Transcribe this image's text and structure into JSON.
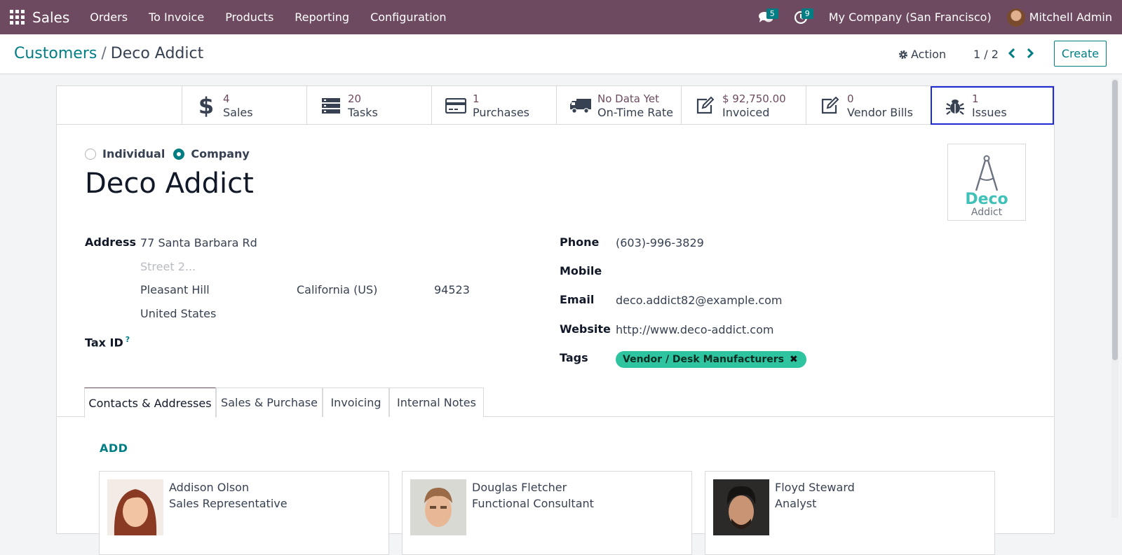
{
  "nav": {
    "app_name": "Sales",
    "menu": [
      "Orders",
      "To Invoice",
      "Products",
      "Reporting",
      "Configuration"
    ],
    "messages_count": "5",
    "activities_count": "9",
    "company": "My Company (San Francisco)",
    "user": "Mitchell Admin",
    "accent_color": "#6d4a60"
  },
  "control": {
    "breadcrumb_parent": "Customers",
    "breadcrumb_separator": "/",
    "breadcrumb_current": "Deco Addict",
    "action_label": "Action",
    "pager": "1 / 2",
    "create_label": "Create"
  },
  "stats": [
    {
      "value": "4",
      "label": "Sales",
      "icon": "dollar-icon"
    },
    {
      "value": "20",
      "label": "Tasks",
      "icon": "tasks-icon"
    },
    {
      "value": "1",
      "label": "Purchases",
      "icon": "credit-card-icon"
    },
    {
      "value": "No Data Yet",
      "label": "On-Time Rate",
      "icon": "truck-icon"
    },
    {
      "value": "$ 92,750.00",
      "label": "Invoiced",
      "icon": "edit-icon"
    },
    {
      "value": "0",
      "label": "Vendor Bills",
      "icon": "edit-icon"
    },
    {
      "value": "1",
      "label": "Issues",
      "icon": "bug-icon"
    }
  ],
  "form": {
    "type_individual": "Individual",
    "type_company": "Company",
    "selected_type": "Company",
    "name": "Deco Addict",
    "logo_text_1": "Deco",
    "logo_text_2": "Addict",
    "address_label": "Address",
    "street": "77 Santa Barbara Rd",
    "street2_placeholder": "Street 2...",
    "city": "Pleasant Hill",
    "state": "California (US)",
    "zip": "94523",
    "country": "United States",
    "tax_id_label": "Tax ID",
    "tax_id_help": "?",
    "phone_label": "Phone",
    "phone": "(603)-996-3829",
    "mobile_label": "Mobile",
    "email_label": "Email",
    "email": "deco.addict82@example.com",
    "website_label": "Website",
    "website": "http://www.deco-addict.com",
    "tags_label": "Tags",
    "tag": "Vendor / Desk Manufacturers",
    "tag_remove": "✖"
  },
  "tabs": [
    "Contacts & Addresses",
    "Sales & Purchase",
    "Invoicing",
    "Internal Notes"
  ],
  "contacts": {
    "add_label": "ADD",
    "items": [
      {
        "name": "Addison Olson",
        "function": "Sales Representative"
      },
      {
        "name": "Douglas Fletcher",
        "function": "Functional Consultant"
      },
      {
        "name": "Floyd Steward",
        "function": "Analyst"
      }
    ]
  }
}
